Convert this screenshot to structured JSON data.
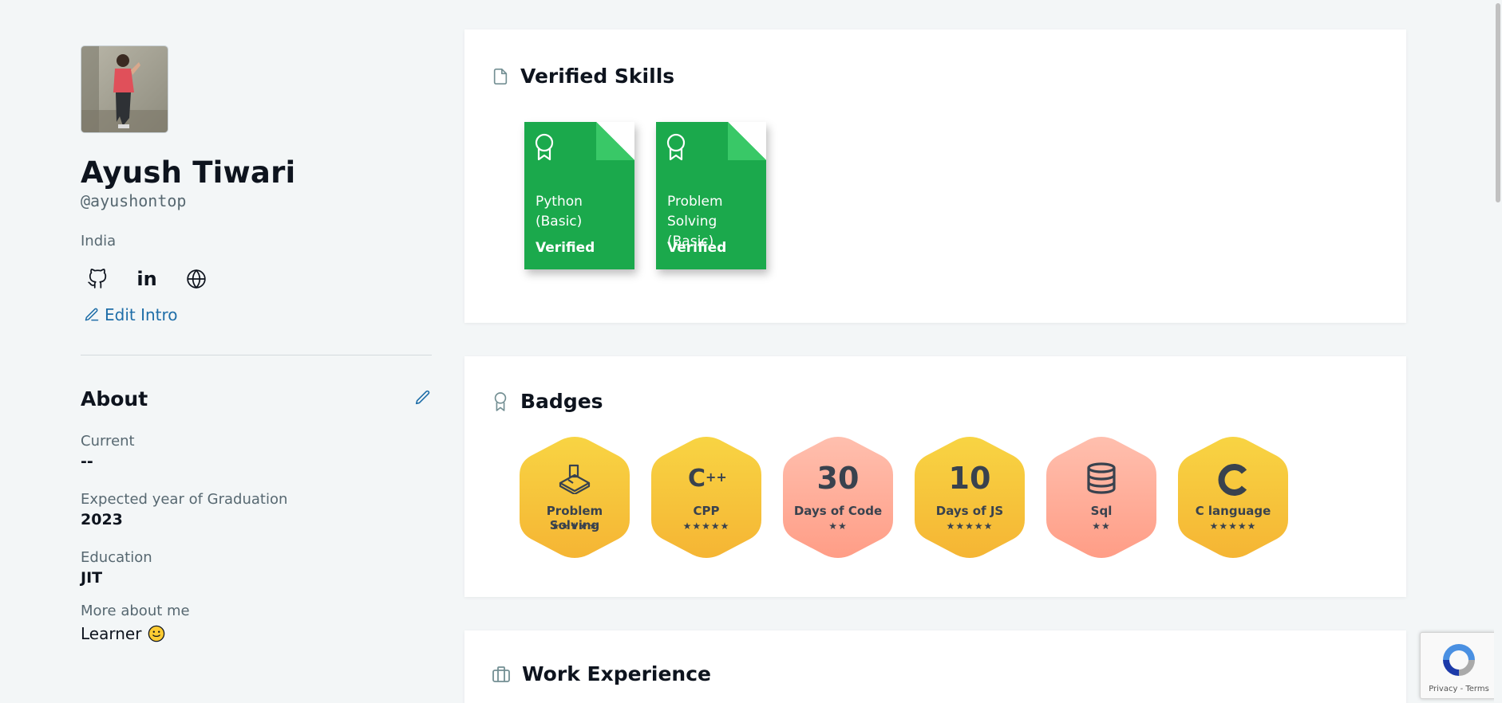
{
  "profile": {
    "name": "Ayush Tiwari",
    "handle": "@ayushontop",
    "country": "India",
    "edit_intro_label": "Edit Intro"
  },
  "about": {
    "title": "About",
    "fields": [
      {
        "label": "Current",
        "value": "--"
      },
      {
        "label": "Expected year of Graduation",
        "value": "2023"
      },
      {
        "label": "Education",
        "value": "JIT"
      }
    ],
    "more_label": "More about me",
    "more_value": "Learner"
  },
  "verified_skills": {
    "title": "Verified Skills",
    "items": [
      {
        "name": "Python (Basic)",
        "status": "Verified"
      },
      {
        "name": "Problem Solving (Basic)",
        "status": "Verified"
      }
    ]
  },
  "badges": {
    "title": "Badges",
    "items": [
      {
        "label": "Problem Solving",
        "stars": "★★★★★",
        "icon": "problem-solving-icon",
        "color": "gold"
      },
      {
        "label": "CPP",
        "stars": "★★★★★",
        "icon": "cpp-icon",
        "color": "gold"
      },
      {
        "label": "Days of Code",
        "number": "30",
        "stars": "★★",
        "color": "salmon"
      },
      {
        "label": "Days of JS",
        "number": "10",
        "stars": "★★★★★",
        "color": "gold"
      },
      {
        "label": "Sql",
        "stars": "★★",
        "icon": "database-icon",
        "color": "salmon"
      },
      {
        "label": "C language",
        "stars": "★★★★★",
        "icon": "c-language-icon",
        "color": "gold"
      }
    ]
  },
  "work_experience": {
    "title": "Work Experience"
  },
  "recaptcha": {
    "text": "Privacy - Terms"
  },
  "colors": {
    "accent_green": "#1ba94c",
    "link_blue": "#1f6ea8",
    "badge_gold": "#f7c934",
    "badge_salmon": "#ffa590"
  }
}
